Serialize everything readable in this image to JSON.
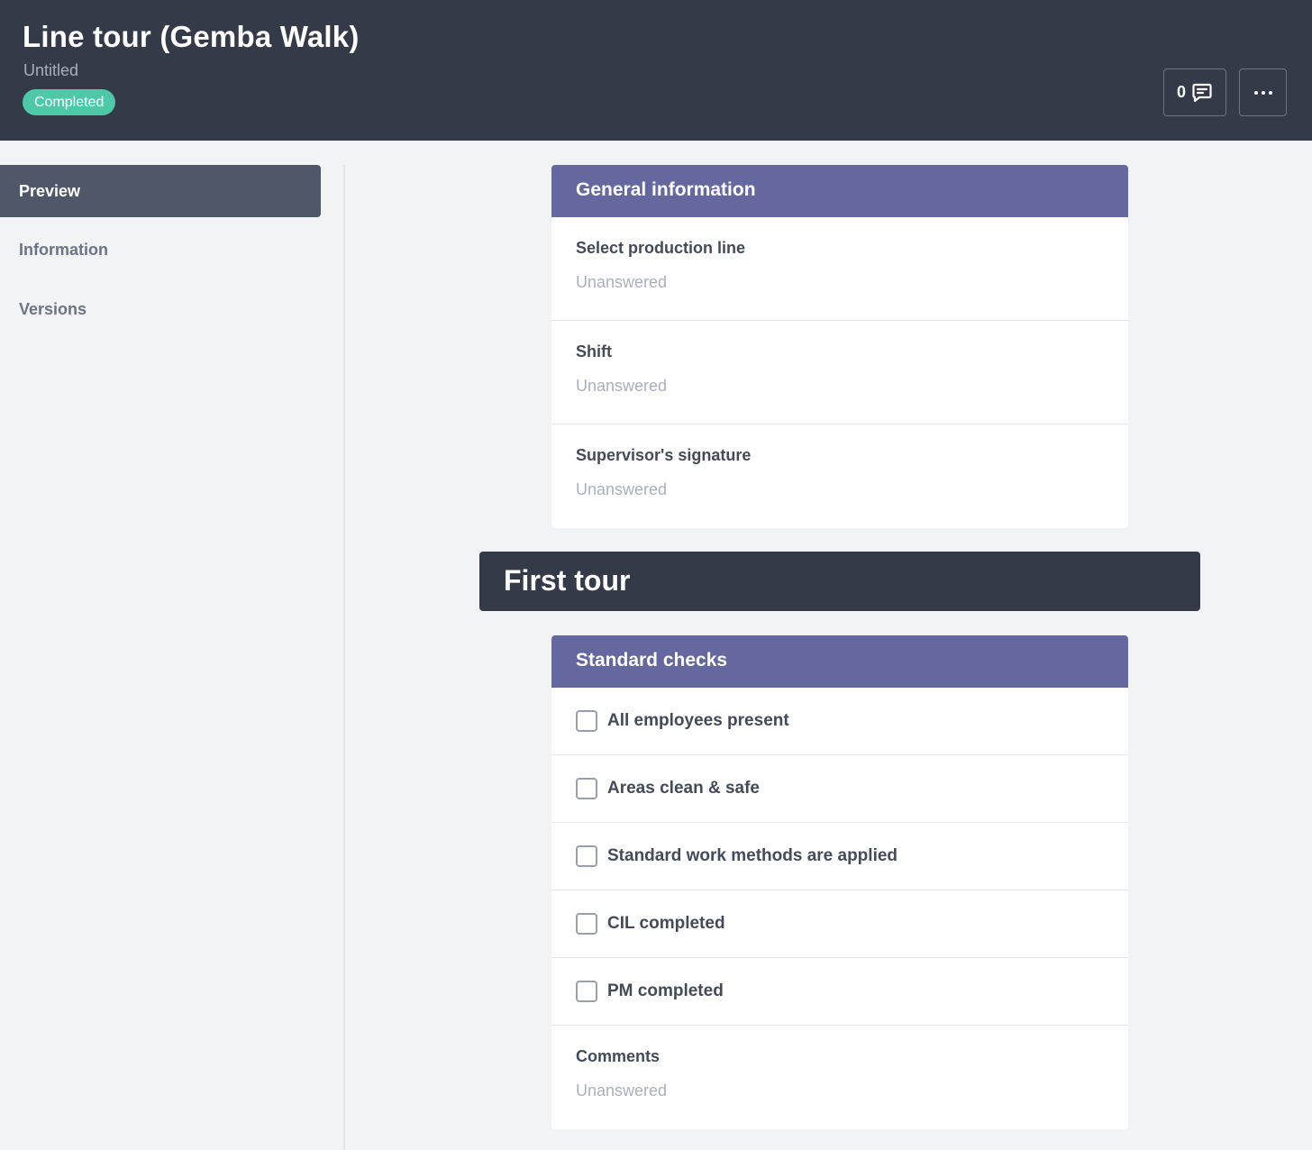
{
  "header": {
    "title": "Line tour (Gemba Walk)",
    "subtitle": "Untitled",
    "status_badge": "Completed",
    "comments_count": "0"
  },
  "sidebar": {
    "items": [
      {
        "label": "Preview",
        "active": true
      },
      {
        "label": "Information",
        "active": false
      },
      {
        "label": "Versions",
        "active": false
      }
    ]
  },
  "general": {
    "heading": "General information",
    "fields": [
      {
        "label": "Select production line",
        "value": "Unanswered"
      },
      {
        "label": "Shift",
        "value": "Unanswered"
      },
      {
        "label": "Supervisor's signature",
        "value": "Unanswered"
      }
    ]
  },
  "section": {
    "title": "First tour"
  },
  "standard_checks": {
    "heading": "Standard checks",
    "items": [
      {
        "label": "All employees present",
        "checked": false
      },
      {
        "label": "Areas clean & safe",
        "checked": false
      },
      {
        "label": "Standard work methods are applied",
        "checked": false
      },
      {
        "label": "CIL completed",
        "checked": false
      },
      {
        "label": "PM completed",
        "checked": false
      }
    ],
    "comments": {
      "label": "Comments",
      "value": "Unanswered"
    }
  },
  "colors": {
    "header_bg": "#343a47",
    "card_head": "#65679f",
    "badge": "#4ec9a8"
  }
}
